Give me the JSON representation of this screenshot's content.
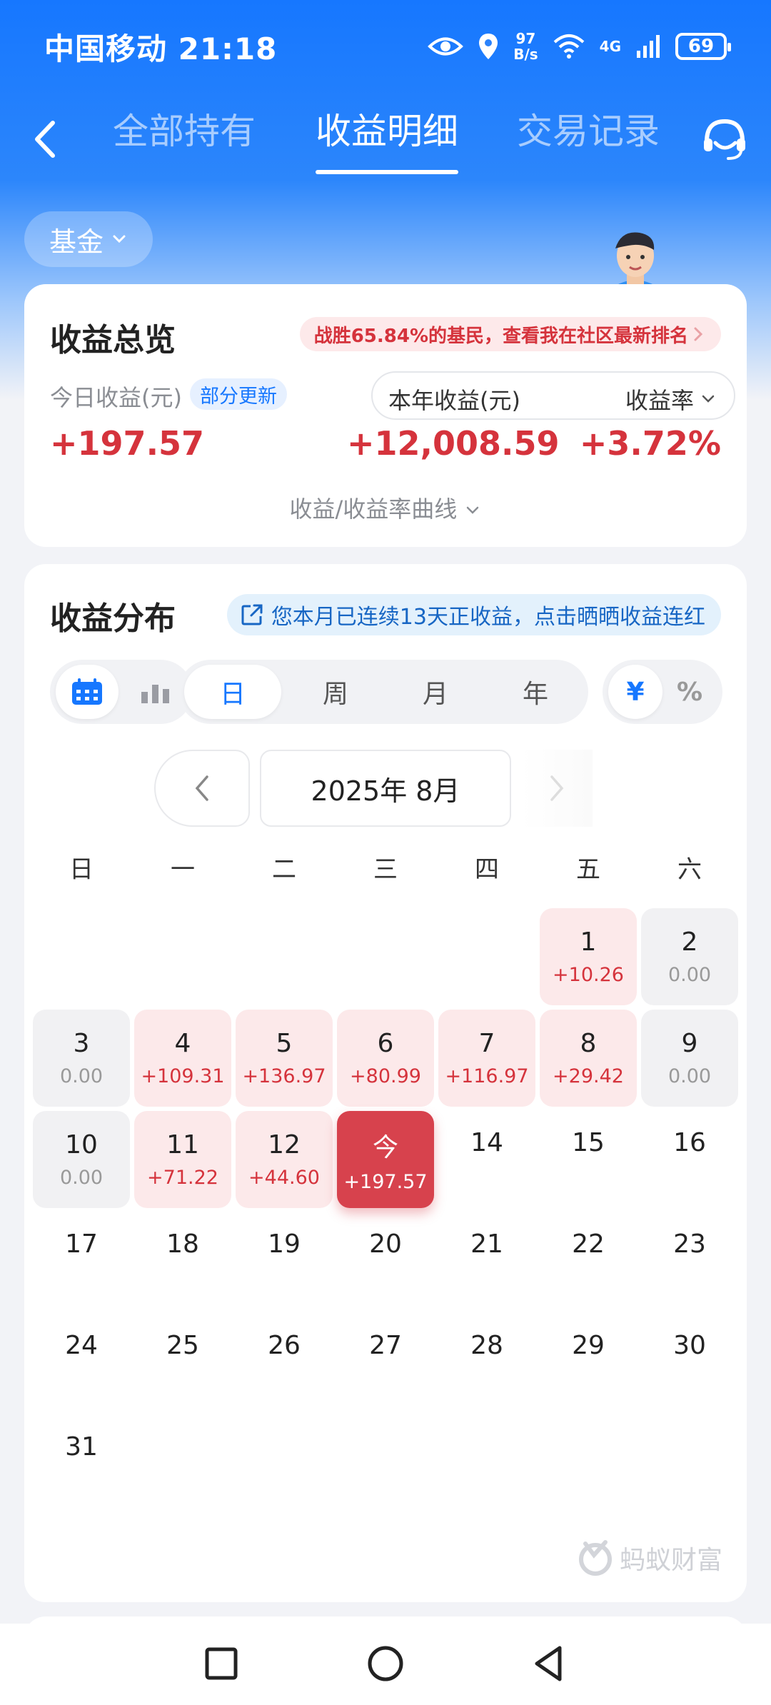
{
  "status": {
    "carrier_time": "中国移动 21:18",
    "net_speed_top": "97",
    "net_speed_unit": "B/s",
    "network": "4G",
    "battery": "69"
  },
  "nav": {
    "tabs": [
      {
        "label": "全部持有"
      },
      {
        "label": "收益明细"
      },
      {
        "label": "交易记录"
      }
    ],
    "active_tab": "收益明细"
  },
  "filter": {
    "label": "基金"
  },
  "overview": {
    "title": "收益总览",
    "rank_text": "战胜65.84%的基民，查看我在社区最新排名",
    "today_label": "今日收益(元)",
    "partial_badge": "部分更新",
    "today_value": "+197.57",
    "year_label": "本年收益(元)",
    "rate_label": "收益率",
    "year_value": "+12,008.59",
    "rate_value": "+3.72%",
    "curve_link": "收益/收益率曲线"
  },
  "distribution": {
    "title": "收益分布",
    "streak_text": "您本月已连续13天正收益，点击晒晒收益连红",
    "periods": [
      "日",
      "周",
      "月",
      "年"
    ],
    "active_period": "日",
    "units": [
      "¥",
      "%"
    ],
    "active_unit": "¥",
    "month_label": "2025年 8月",
    "weekdays": [
      "日",
      "一",
      "二",
      "三",
      "四",
      "五",
      "六"
    ],
    "days": [
      {
        "num": "1",
        "amt": "+10.26",
        "kind": "pos"
      },
      {
        "num": "2",
        "amt": "0.00",
        "kind": "zero"
      },
      {
        "num": "3",
        "amt": "0.00",
        "kind": "zero"
      },
      {
        "num": "4",
        "amt": "+109.31",
        "kind": "pos"
      },
      {
        "num": "5",
        "amt": "+136.97",
        "kind": "pos"
      },
      {
        "num": "6",
        "amt": "+80.99",
        "kind": "pos"
      },
      {
        "num": "7",
        "amt": "+116.97",
        "kind": "pos"
      },
      {
        "num": "8",
        "amt": "+29.42",
        "kind": "pos"
      },
      {
        "num": "9",
        "amt": "0.00",
        "kind": "zero"
      },
      {
        "num": "10",
        "amt": "0.00",
        "kind": "zero"
      },
      {
        "num": "11",
        "amt": "+71.22",
        "kind": "pos"
      },
      {
        "num": "12",
        "amt": "+44.60",
        "kind": "pos"
      },
      {
        "num": "今",
        "amt": "+197.57",
        "kind": "today"
      },
      {
        "num": "14",
        "amt": "",
        "kind": "future"
      },
      {
        "num": "15",
        "amt": "",
        "kind": "future"
      },
      {
        "num": "16",
        "amt": "",
        "kind": "future"
      },
      {
        "num": "17",
        "amt": "",
        "kind": "future"
      },
      {
        "num": "18",
        "amt": "",
        "kind": "future"
      },
      {
        "num": "19",
        "amt": "",
        "kind": "future"
      },
      {
        "num": "20",
        "amt": "",
        "kind": "future"
      },
      {
        "num": "21",
        "amt": "",
        "kind": "future"
      },
      {
        "num": "22",
        "amt": "",
        "kind": "future"
      },
      {
        "num": "23",
        "amt": "",
        "kind": "future"
      },
      {
        "num": "24",
        "amt": "",
        "kind": "future"
      },
      {
        "num": "25",
        "amt": "",
        "kind": "future"
      },
      {
        "num": "26",
        "amt": "",
        "kind": "future"
      },
      {
        "num": "27",
        "amt": "",
        "kind": "future"
      },
      {
        "num": "28",
        "amt": "",
        "kind": "future"
      },
      {
        "num": "29",
        "amt": "",
        "kind": "future"
      },
      {
        "num": "30",
        "amt": "",
        "kind": "future"
      },
      {
        "num": "31",
        "amt": "",
        "kind": "future"
      }
    ],
    "watermark": "蚂蚁财富"
  },
  "colors": {
    "brand_blue": "#1677ff",
    "gain_red": "#d5333c",
    "gain_bg": "#fce9ea",
    "today_red": "#d7424d"
  }
}
